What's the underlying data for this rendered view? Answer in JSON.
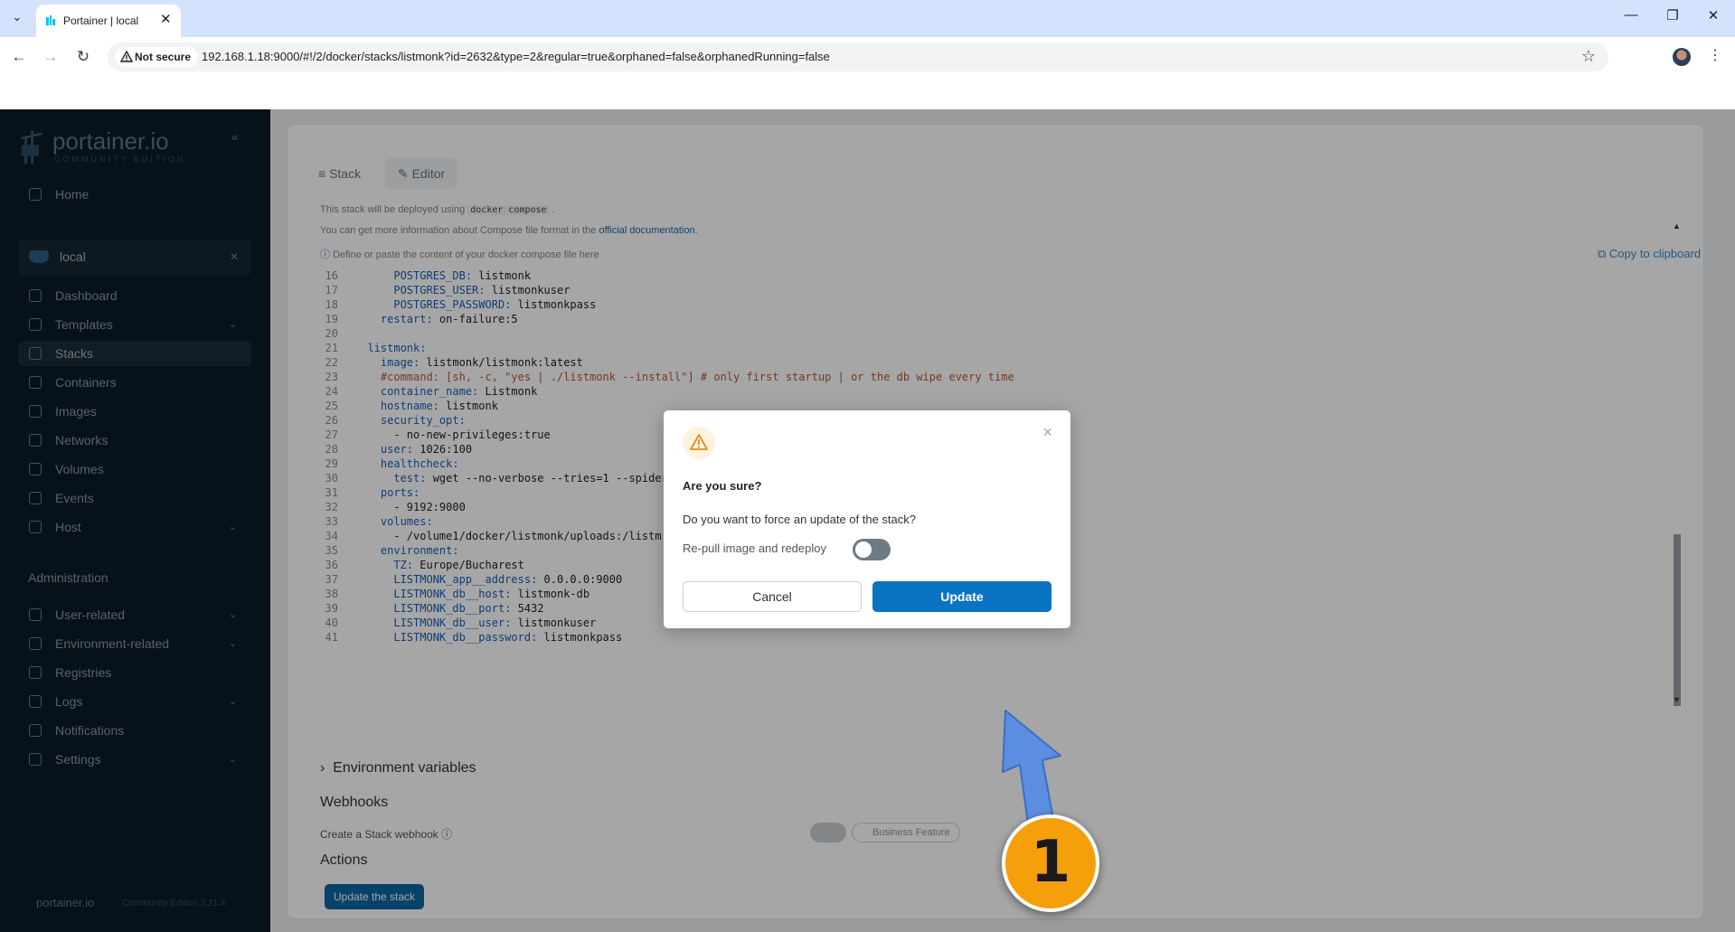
{
  "browser": {
    "tab_title": "Portainer | local",
    "not_secure": "Not secure",
    "url": "192.168.1.18:9000/#!/2/docker/stacks/listmonk?id=2632&type=2&regular=true&orphaned=false&orphanedRunning=false"
  },
  "sidebar": {
    "logo_text": "portainer.io",
    "logo_sub": "COMMUNITY EDITION",
    "home": "Home",
    "env_name": "local",
    "env_items": [
      {
        "label": "Dashboard",
        "icon": "dashboard-icon"
      },
      {
        "label": "Templates",
        "icon": "templates-icon"
      },
      {
        "label": "Stacks",
        "icon": "stacks-icon"
      },
      {
        "label": "Containers",
        "icon": "containers-icon"
      },
      {
        "label": "Images",
        "icon": "images-icon"
      },
      {
        "label": "Networks",
        "icon": "networks-icon"
      },
      {
        "label": "Volumes",
        "icon": "volumes-icon"
      },
      {
        "label": "Events",
        "icon": "events-icon"
      },
      {
        "label": "Host",
        "icon": "host-icon"
      }
    ],
    "admin_heading": "Administration",
    "admin_items": [
      {
        "label": "User-related"
      },
      {
        "label": "Environment-related"
      },
      {
        "label": "Registries"
      },
      {
        "label": "Logs"
      },
      {
        "label": "Notifications"
      },
      {
        "label": "Settings"
      }
    ],
    "footer_brand": "portainer.io",
    "footer_version": "Community Edition 2.21.4"
  },
  "main": {
    "tabs": [
      "Stack",
      "Editor"
    ],
    "info_line1_pre": "This stack will be deployed using",
    "info_line1_code": "docker compose",
    "info_line2_pre": "You can get more information about Compose file format in the",
    "info_line2_link": "official documentation",
    "define_hint": "Define or paste the content of your docker compose file here",
    "copy_clipboard": "Copy to clipboard",
    "code_lines": [
      {
        "n": "16",
        "indent": "      ",
        "key": "POSTGRES_DB:",
        "val": " listmonk"
      },
      {
        "n": "17",
        "indent": "      ",
        "key": "POSTGRES_USER:",
        "val": " listmonkuser"
      },
      {
        "n": "18",
        "indent": "      ",
        "key": "POSTGRES_PASSWORD:",
        "val": " listmonkpass"
      },
      {
        "n": "19",
        "indent": "    ",
        "key": "restart:",
        "val": " on-failure:5"
      },
      {
        "n": "20",
        "indent": "",
        "key": "",
        "val": ""
      },
      {
        "n": "21",
        "indent": "  ",
        "key": "listmonk:",
        "val": ""
      },
      {
        "n": "22",
        "indent": "    ",
        "key": "image:",
        "val": " listmonk/listmonk:latest"
      },
      {
        "n": "23",
        "indent": "    ",
        "key": "",
        "val": "",
        "comment": "#command: [sh, -c, \"yes | ./listmonk --install\"] # only first startup | or the db wipe every time"
      },
      {
        "n": "24",
        "indent": "    ",
        "key": "container_name:",
        "val": " Listmonk"
      },
      {
        "n": "25",
        "indent": "    ",
        "key": "hostname:",
        "val": " listmonk"
      },
      {
        "n": "26",
        "indent": "    ",
        "key": "security_opt:",
        "val": ""
      },
      {
        "n": "27",
        "indent": "      ",
        "key": "",
        "val": "- no-new-privileges:true"
      },
      {
        "n": "28",
        "indent": "    ",
        "key": "user:",
        "val": " 1026:100"
      },
      {
        "n": "29",
        "indent": "    ",
        "key": "healthcheck:",
        "val": ""
      },
      {
        "n": "30",
        "indent": "      ",
        "key": "test:",
        "val": " wget --no-verbose --tries=1 --spider"
      },
      {
        "n": "31",
        "indent": "    ",
        "key": "ports:",
        "val": ""
      },
      {
        "n": "32",
        "indent": "      ",
        "key": "",
        "val": "- 9192:9000"
      },
      {
        "n": "33",
        "indent": "    ",
        "key": "volumes:",
        "val": ""
      },
      {
        "n": "34",
        "indent": "      ",
        "key": "",
        "val": "- /volume1/docker/listmonk/uploads:/listm"
      },
      {
        "n": "35",
        "indent": "    ",
        "key": "environment:",
        "val": ""
      },
      {
        "n": "36",
        "indent": "      ",
        "key": "TZ:",
        "val": " Europe/Bucharest"
      },
      {
        "n": "37",
        "indent": "      ",
        "key": "LISTMONK_app__address:",
        "val": " 0.0.0.0:9000"
      },
      {
        "n": "38",
        "indent": "      ",
        "key": "LISTMONK_db__host:",
        "val": " listmonk-db"
      },
      {
        "n": "39",
        "indent": "      ",
        "key": "LISTMONK_db__port:",
        "val": " 5432"
      },
      {
        "n": "40",
        "indent": "      ",
        "key": "LISTMONK_db__user:",
        "val": " listmonkuser"
      },
      {
        "n": "41",
        "indent": "      ",
        "key": "LISTMONK_db__password:",
        "val": " listmonkpass"
      }
    ],
    "env_vars": "Environment variables",
    "webhooks": "Webhooks",
    "webhook_label": "Create a Stack webhook",
    "business_feature": "Business Feature",
    "actions": "Actions",
    "update_stack_btn": "Update the stack"
  },
  "modal": {
    "title": "Are you sure?",
    "question": "Do you want to force an update of the stack?",
    "repull_label": "Re-pull image and redeploy",
    "repull_enabled": false,
    "cancel": "Cancel",
    "update": "Update"
  },
  "annotation": {
    "step": "1"
  },
  "colors": {
    "sidebar_bg": "#0b1b28",
    "primary": "#0b73c4",
    "badge": "#f59f0a",
    "arrow": "#5b8de0"
  }
}
